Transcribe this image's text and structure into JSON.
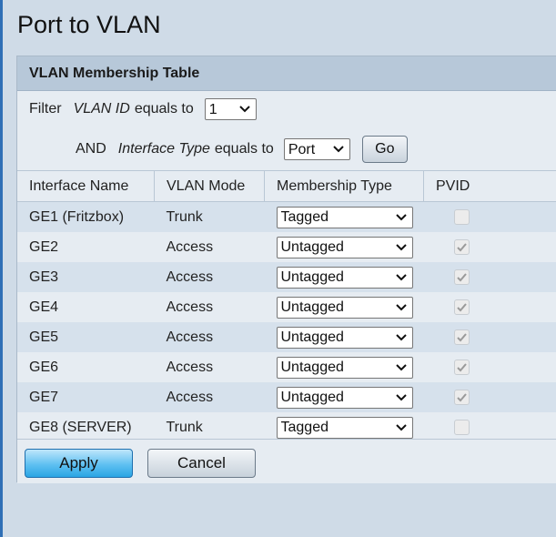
{
  "page": {
    "title": "Port to VLAN"
  },
  "panel": {
    "header": "VLAN Membership Table"
  },
  "filter": {
    "filter_label": "Filter",
    "vlan_field": "VLAN ID",
    "vlan_op": "equals to",
    "vlan_value": "1",
    "and_label": "AND",
    "iface_field": "Interface Type",
    "iface_op": "equals to",
    "iface_value": "Port",
    "go_label": "Go"
  },
  "table": {
    "columns": [
      "Interface Name",
      "VLAN Mode",
      "Membership Type",
      "PVID"
    ],
    "rows": [
      {
        "name": "GE1 (Fritzbox)",
        "mode": "Trunk",
        "membership": "Tagged",
        "pvid": false
      },
      {
        "name": "GE2",
        "mode": "Access",
        "membership": "Untagged",
        "pvid": true
      },
      {
        "name": "GE3",
        "mode": "Access",
        "membership": "Untagged",
        "pvid": true
      },
      {
        "name": "GE4",
        "mode": "Access",
        "membership": "Untagged",
        "pvid": true
      },
      {
        "name": "GE5",
        "mode": "Access",
        "membership": "Untagged",
        "pvid": true
      },
      {
        "name": "GE6",
        "mode": "Access",
        "membership": "Untagged",
        "pvid": true
      },
      {
        "name": "GE7",
        "mode": "Access",
        "membership": "Untagged",
        "pvid": true
      },
      {
        "name": "GE8 (SERVER)",
        "mode": "Trunk",
        "membership": "Tagged",
        "pvid": false
      }
    ]
  },
  "buttons": {
    "apply": "Apply",
    "cancel": "Cancel"
  },
  "colors": {
    "accent": "#2aa5e4",
    "header_bg": "#b7c8d9",
    "row_alt": "#d6e1ec"
  }
}
